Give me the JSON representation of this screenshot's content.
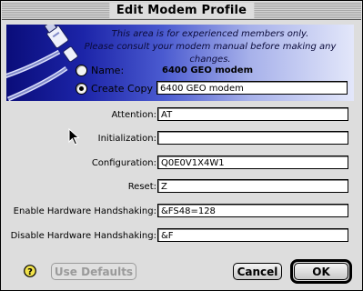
{
  "window": {
    "title": "Edit Modem Profile"
  },
  "banner": {
    "line1": "This area is for experienced members only.",
    "line2": "Please consult your modem manual before making any changes."
  },
  "profile": {
    "name_label": "Name:",
    "name_value": "6400 GEO modem",
    "create_copy_label": "Create Copy As",
    "create_copy_value": "6400 GEO modem",
    "selected": "create_copy"
  },
  "fields": [
    {
      "label": "Attention:",
      "value": "AT"
    },
    {
      "label": "Initialization:",
      "value": ""
    },
    {
      "label": "Configuration:",
      "value": "Q0E0V1X4W1"
    },
    {
      "label": "Reset:",
      "value": "Z"
    },
    {
      "label": "Enable Hardware Handshaking:",
      "value": "&FS48=128"
    },
    {
      "label": "Disable Hardware Handshaking:",
      "value": "&F"
    }
  ],
  "buttons": {
    "use_defaults": "Use Defaults",
    "cancel": "Cancel",
    "ok": "OK"
  },
  "icons": {
    "help": "question-mark-icon",
    "cursor": "arrow-cursor-icon",
    "banner_art": "modem-cable-icon"
  }
}
